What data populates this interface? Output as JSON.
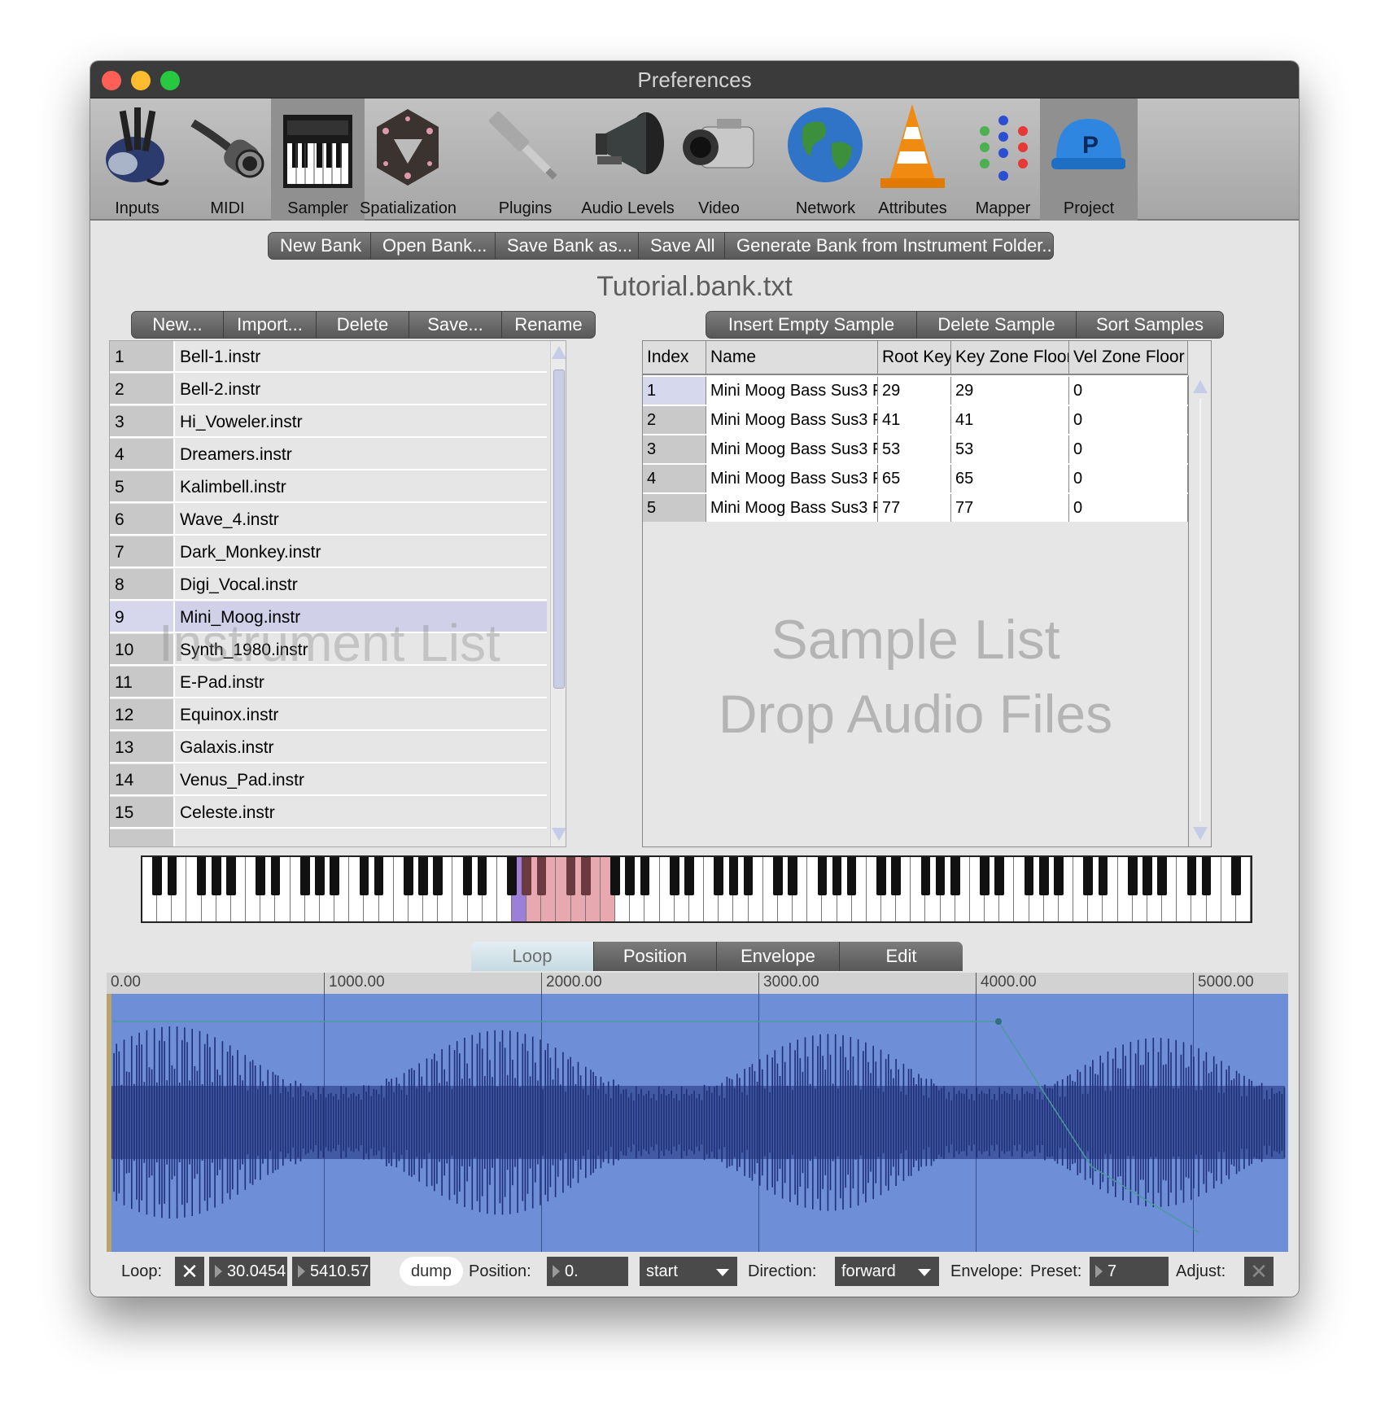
{
  "window": {
    "title": "Preferences"
  },
  "toolbar": {
    "items": [
      {
        "label": "Inputs",
        "icon": "glove-icon"
      },
      {
        "label": "MIDI",
        "icon": "midi-cable-icon"
      },
      {
        "label": "Sampler",
        "icon": "keyboard-synth-icon",
        "selected": true
      },
      {
        "label": "Spatialization",
        "icon": "speaker-sphere-icon"
      },
      {
        "label": "Plugins",
        "icon": "audio-jack-icon"
      },
      {
        "label": "Audio Levels",
        "icon": "loudspeaker-horn-icon"
      },
      {
        "label": "Video",
        "icon": "camcorder-icon"
      },
      {
        "label": "Network",
        "icon": "globe-icon"
      },
      {
        "label": "Attributes",
        "icon": "traffic-cone-icon"
      },
      {
        "label": "Mapper",
        "icon": "node-graph-icon"
      },
      {
        "label": "Project",
        "icon": "hard-hat-icon"
      }
    ]
  },
  "bank_buttons": [
    "New Bank",
    "Open Bank...",
    "Save Bank as...",
    "Save All",
    "Generate Bank from Instrument Folder..."
  ],
  "bank_name": "Tutorial.bank.txt",
  "instrument_buttons": [
    "New...",
    "Import...",
    "Delete",
    "Save...",
    "Rename"
  ],
  "sample_buttons": [
    "Insert Empty Sample",
    "Delete Sample",
    "Sort Samples"
  ],
  "instrument_list": {
    "watermark": "Instrument List",
    "selected_index": 9,
    "rows": [
      {
        "n": "1",
        "name": "Bell-1.instr"
      },
      {
        "n": "2",
        "name": "Bell-2.instr"
      },
      {
        "n": "3",
        "name": "Hi_Voweler.instr"
      },
      {
        "n": "4",
        "name": "Dreamers.instr"
      },
      {
        "n": "5",
        "name": "Kalimbell.instr"
      },
      {
        "n": "6",
        "name": "Wave_4.instr"
      },
      {
        "n": "7",
        "name": "Dark_Monkey.instr"
      },
      {
        "n": "8",
        "name": "Digi_Vocal.instr"
      },
      {
        "n": "9",
        "name": "Mini_Moog.instr"
      },
      {
        "n": "10",
        "name": "Synth_1980.instr"
      },
      {
        "n": "11",
        "name": "E-Pad.instr"
      },
      {
        "n": "12",
        "name": "Equinox.instr"
      },
      {
        "n": "13",
        "name": "Galaxis.instr"
      },
      {
        "n": "14",
        "name": "Venus_Pad.instr"
      },
      {
        "n": "15",
        "name": "Celeste.instr"
      }
    ]
  },
  "sample_table": {
    "columns": [
      "Index",
      "Name",
      "Root Key",
      "Key Zone Floor",
      "Vel Zone Floor"
    ],
    "rows": [
      [
        "1",
        "Mini Moog Bass Sus3 F",
        "29",
        "29",
        "0"
      ],
      [
        "2",
        "Mini Moog Bass Sus3 F",
        "41",
        "41",
        "0"
      ],
      [
        "3",
        "Mini Moog Bass Sus3 F",
        "53",
        "53",
        "0"
      ],
      [
        "4",
        "Mini Moog Bass Sus3 F",
        "65",
        "65",
        "0"
      ],
      [
        "5",
        "Mini Moog Bass Sus3 F",
        "77",
        "77",
        "0"
      ]
    ],
    "watermark_1": "Sample List",
    "watermark_2": "Drop Audio Files"
  },
  "editor_tabs": [
    "Loop",
    "Position",
    "Envelope",
    "Edit"
  ],
  "active_tab": "Loop",
  "ruler": [
    "0.00",
    "1000.00",
    "2000.00",
    "3000.00",
    "4000.00",
    "5000.00"
  ],
  "status": {
    "loop_label": "Loop:",
    "loop_start": "30.0454",
    "loop_end": "5410.57",
    "dump_label": "dump",
    "position_label": "Position:",
    "position_value": "0.",
    "position_mode": "start",
    "direction_label": "Direction:",
    "direction_value": "forward",
    "envelope_label": "Envelope:",
    "preset_label": "Preset:",
    "preset_value": "7",
    "adjust_label": "Adjust:"
  },
  "colors": {
    "waveform_bg": "#6e8ed8",
    "waveform_fg": "#1f2f78",
    "selected_key": "#9b7fd8",
    "zone_key": "#e8a8b0"
  }
}
